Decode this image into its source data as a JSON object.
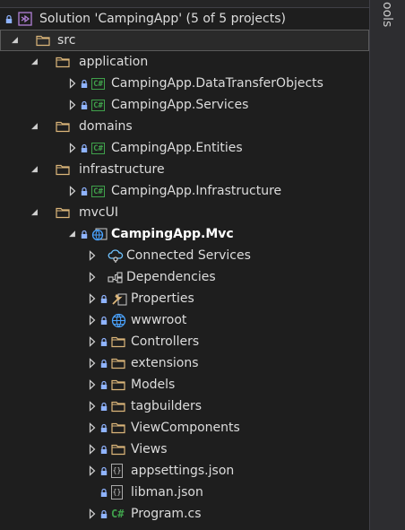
{
  "side_panel": {
    "label": "ools"
  },
  "tree": {
    "rows": [
      {
        "name": "solution-row",
        "label": "Solution 'CampingApp' (5 of 5 projects)",
        "icon": "solution-icon",
        "lock": true,
        "chevron": "none",
        "level": 0
      },
      {
        "name": "folder-src",
        "label": "src",
        "icon": "folder-icon",
        "lock": false,
        "chevron": "expanded",
        "level": 1,
        "selected": true
      },
      {
        "name": "folder-application",
        "label": "application",
        "icon": "folder-icon",
        "lock": false,
        "chevron": "expanded",
        "level": 2
      },
      {
        "name": "project-dto",
        "label": "CampingApp.DataTransferObjects",
        "icon": "csharp-project-icon",
        "lock": true,
        "chevron": "collapsed",
        "level": 3
      },
      {
        "name": "project-services",
        "label": "CampingApp.Services",
        "icon": "csharp-project-icon",
        "lock": true,
        "chevron": "collapsed",
        "level": 3
      },
      {
        "name": "folder-domains",
        "label": "domains",
        "icon": "folder-icon",
        "lock": false,
        "chevron": "expanded",
        "level": 2
      },
      {
        "name": "project-entities",
        "label": "CampingApp.Entities",
        "icon": "csharp-project-icon",
        "lock": true,
        "chevron": "collapsed",
        "level": 3
      },
      {
        "name": "folder-infrastructure",
        "label": "infrastructure",
        "icon": "folder-icon",
        "lock": false,
        "chevron": "expanded",
        "level": 2
      },
      {
        "name": "project-infrastructure",
        "label": "CampingApp.Infrastructure",
        "icon": "csharp-project-icon",
        "lock": true,
        "chevron": "collapsed",
        "level": 3
      },
      {
        "name": "folder-mvcui",
        "label": "mvcUI",
        "icon": "folder-icon",
        "lock": false,
        "chevron": "expanded",
        "level": 2
      },
      {
        "name": "project-mvc",
        "label": "CampingApp.Mvc",
        "icon": "web-project-icon",
        "lock": true,
        "chevron": "expanded",
        "level": 3,
        "bold": true
      },
      {
        "name": "node-connected-services",
        "label": "Connected Services",
        "icon": "connected-services-icon",
        "lock": false,
        "chevron": "collapsed",
        "level": 4
      },
      {
        "name": "node-dependencies",
        "label": "Dependencies",
        "icon": "dependencies-icon",
        "lock": false,
        "chevron": "collapsed",
        "level": 4
      },
      {
        "name": "node-properties",
        "label": "Properties",
        "icon": "properties-wrench-icon",
        "lock": true,
        "chevron": "collapsed",
        "level": 4
      },
      {
        "name": "node-wwwroot",
        "label": "wwwroot",
        "icon": "globe-icon",
        "lock": true,
        "chevron": "collapsed",
        "level": 4
      },
      {
        "name": "folder-controllers",
        "label": "Controllers",
        "icon": "folder-icon",
        "lock": true,
        "chevron": "collapsed",
        "level": 4
      },
      {
        "name": "folder-extensions",
        "label": "extensions",
        "icon": "folder-icon",
        "lock": true,
        "chevron": "collapsed",
        "level": 4
      },
      {
        "name": "folder-models",
        "label": "Models",
        "icon": "folder-icon",
        "lock": true,
        "chevron": "collapsed",
        "level": 4
      },
      {
        "name": "folder-tagbuilders",
        "label": "tagbuilders",
        "icon": "folder-icon",
        "lock": true,
        "chevron": "collapsed",
        "level": 4
      },
      {
        "name": "folder-viewcomponents",
        "label": "ViewComponents",
        "icon": "folder-icon",
        "lock": true,
        "chevron": "collapsed",
        "level": 4
      },
      {
        "name": "folder-views",
        "label": "Views",
        "icon": "folder-icon",
        "lock": true,
        "chevron": "collapsed",
        "level": 4
      },
      {
        "name": "file-appsettings",
        "label": "appsettings.json",
        "icon": "json-file-icon",
        "lock": true,
        "chevron": "collapsed",
        "level": 4
      },
      {
        "name": "file-libman",
        "label": "libman.json",
        "icon": "json-file-icon",
        "lock": true,
        "chevron": "none",
        "level": 4
      },
      {
        "name": "file-program",
        "label": "Program.cs",
        "icon": "csharp-file-icon",
        "lock": true,
        "chevron": "collapsed",
        "level": 4
      }
    ]
  },
  "colors": {
    "background": "#1e1e1e",
    "text": "#dcdcdc",
    "folder": "#dcb67a",
    "csharp": "#3fa14b",
    "lock": "#8fb3ff",
    "solution": "#b180d7"
  }
}
